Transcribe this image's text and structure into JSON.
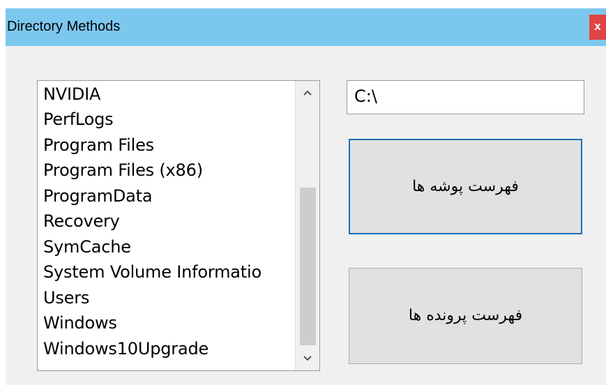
{
  "window": {
    "title": "Directory Methods",
    "close_label": "x"
  },
  "listbox": {
    "items": [
      "NVIDIA",
      "PerfLogs",
      "Program Files",
      "Program Files (x86)",
      "ProgramData",
      "Recovery",
      "SymCache",
      "System Volume Informatio",
      "Users",
      "Windows",
      "Windows10Upgrade"
    ],
    "scroll_up_icon": "chevron-up",
    "scroll_down_icon": "chevron-down"
  },
  "path_input": {
    "value": "C:\\"
  },
  "buttons": {
    "list_folders_label": "فهرست پوشه ها",
    "list_files_label": "فهرست پرونده ها"
  },
  "colors": {
    "titlebar": "#7cc7ee",
    "close_button": "#e04343",
    "focused_button_border": "#1f6fb8",
    "window_background": "#f0f0f0"
  }
}
